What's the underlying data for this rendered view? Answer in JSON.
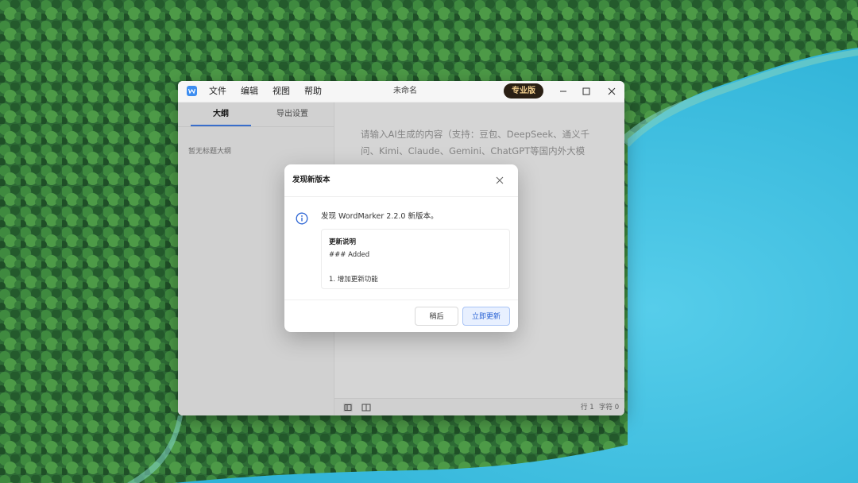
{
  "menu": {
    "items": [
      "文件",
      "编辑",
      "视图",
      "帮助"
    ]
  },
  "window": {
    "title": "未命名",
    "pro_badge": "专业版"
  },
  "sidebar": {
    "tabs": [
      {
        "label": "大纲",
        "active": true
      },
      {
        "label": "导出设置",
        "active": false
      }
    ],
    "empty_outline": "暂无标题大纲"
  },
  "editor": {
    "placeholder": "请输入AI生成的内容（支持：豆包、DeepSeek、通义千问、Kimi、Claude、Gemini、ChatGPT等国内外大模"
  },
  "statusbar": {
    "line": "行 1",
    "chars": "字符 0"
  },
  "dialog": {
    "title": "发现新版本",
    "message": "发现 WordMarker 2.2.0 新版本。",
    "notes_title": "更新说明",
    "notes_lines": [
      "### Added",
      "1. 增加更新功能"
    ],
    "later_button": "稍后",
    "update_button": "立即更新"
  },
  "colors": {
    "accent": "#3d7ef0",
    "pro_badge_bg": "#2a1f14",
    "pro_badge_text": "#f2cf8e",
    "lake": "#3fbfe0",
    "forest": "#2f6b3a"
  }
}
